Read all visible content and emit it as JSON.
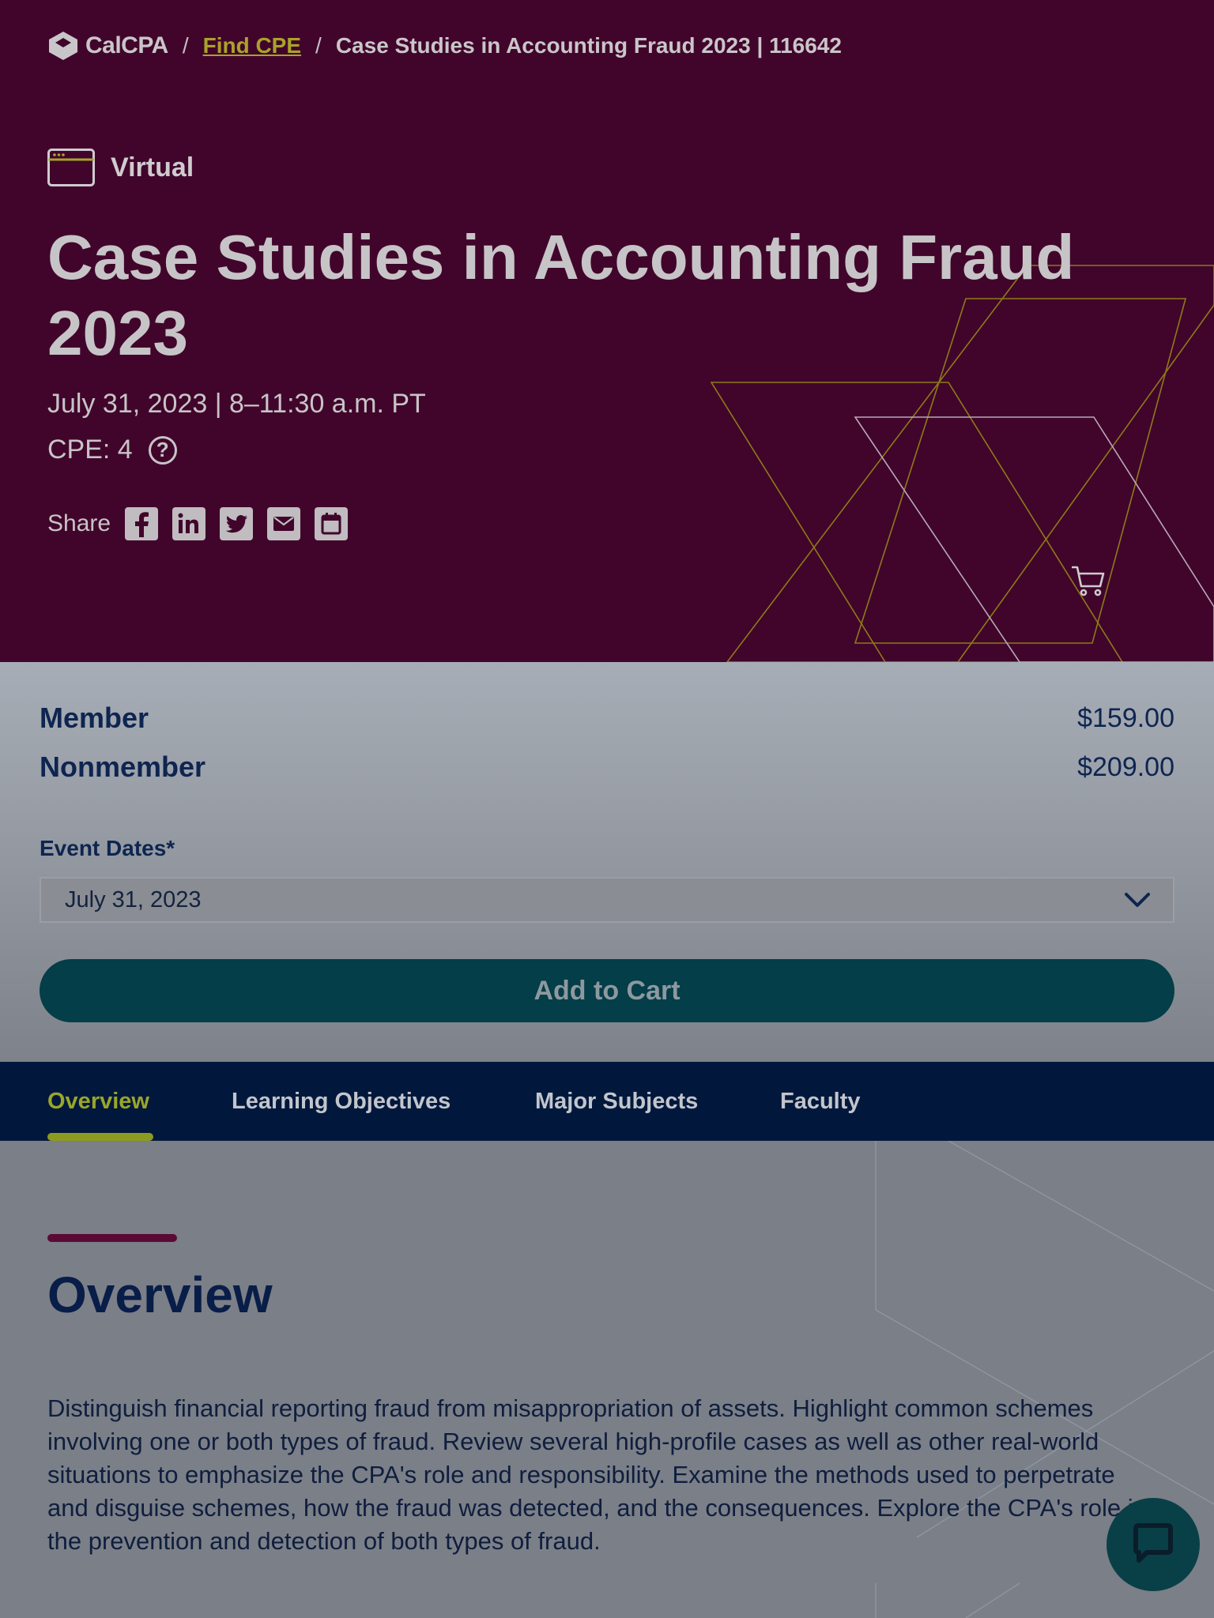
{
  "breadcrumb": {
    "logo_text": "CalCPA",
    "separator": "/",
    "find_cpe": "Find CPE",
    "current": "Case Studies in Accounting Fraud 2023 | 116642"
  },
  "event": {
    "format": "Virtual",
    "title": "Case Studies in Accounting Fraud 2023",
    "date_time": "July 31, 2023 | 8–11:30 a.m. PT",
    "cpe": "CPE: 4",
    "help_symbol": "?",
    "share_label": "Share",
    "share_icons": [
      "facebook-icon",
      "linkedin-icon",
      "twitter-icon",
      "email-icon",
      "calendar-icon"
    ]
  },
  "pricing": {
    "member_label": "Member",
    "member_price": "$159.00",
    "nonmember_label": "Nonmember",
    "nonmember_price": "$209.00"
  },
  "event_dates": {
    "label": "Event Dates*",
    "selected": "July 31, 2023"
  },
  "cart": {
    "button_label": "Add to Cart"
  },
  "tabs": {
    "items": [
      "Overview",
      "Learning Objectives",
      "Major Subjects",
      "Faculty"
    ],
    "active": "Overview"
  },
  "overview": {
    "heading": "Overview",
    "body": "Distinguish financial reporting fraud from misappropriation of assets. Highlight common schemes involving one or both types of fraud. Review several high-profile cases as well as other real-world situations to emphasize the CPA's role and responsibility. Examine the methods used to perpetrate and disguise schemes, how the fraud was detected, and the consequences. Explore the CPA's role in the prevention and detection of both types of fraud."
  },
  "colors": {
    "hero_bg": "#41052b",
    "accent_gold": "#a8a32a",
    "nav_bg": "#01183c",
    "button_bg": "#043e48",
    "heading_navy": "#081d48"
  }
}
